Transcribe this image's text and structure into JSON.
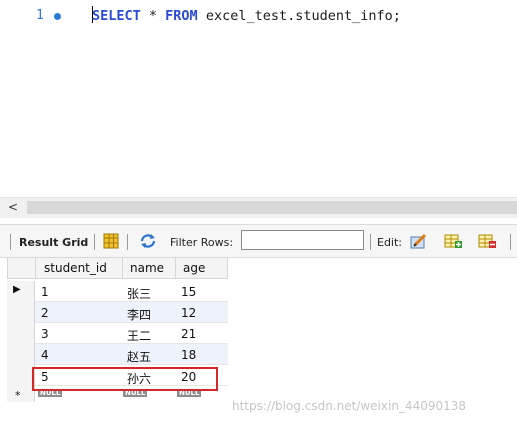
{
  "editor": {
    "line_number": "1",
    "query": {
      "kw_select": "SELECT",
      "star": " * ",
      "kw_from": "FROM",
      "rest": " excel_test.student_info;"
    }
  },
  "scrollbar": {
    "left_arrow": "<"
  },
  "toolbar": {
    "result_grid_label": "Result Grid",
    "filter_rows_label": "Filter Rows:",
    "filter_value": "",
    "edit_label": "Edit:"
  },
  "grid": {
    "columns": [
      "student_id",
      "name",
      "age"
    ],
    "rows": [
      [
        "1",
        "张三",
        "15"
      ],
      [
        "2",
        "李四",
        "12"
      ],
      [
        "3",
        "王二",
        "21"
      ],
      [
        "4",
        "赵五",
        "18"
      ],
      [
        "5",
        "孙六",
        "20"
      ]
    ],
    "null_label": "NULL",
    "current_row_marker": "▶",
    "new_row_marker": "*"
  },
  "watermark": "https://blog.csdn.net/weixin_44090138",
  "colors": {
    "keyword": "#2a4bd7",
    "line_number": "#2b7bd6",
    "highlight": "#d42727"
  }
}
